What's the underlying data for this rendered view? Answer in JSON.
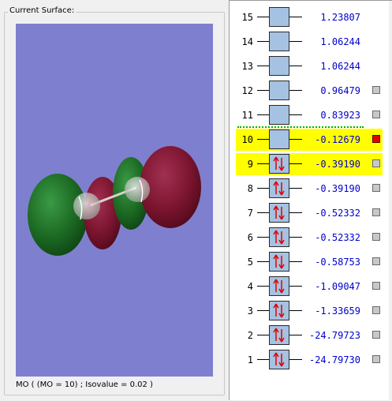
{
  "panel": {
    "group_title": "Current Surface:",
    "status": "MO ( (MO = 10) ; Isovalue = 0.02 )"
  },
  "colors": {
    "viewport_bg": "#7f7fcf",
    "positive_lobe": "#1d6b24",
    "negative_lobe": "#7c1530",
    "highlight": "#ffff00",
    "energy_text": "#0000cc",
    "selected_marker": "#e00000"
  },
  "orbitals": [
    {
      "num": "15",
      "energy": "1.23807",
      "occupied": false,
      "highlight": false,
      "checkbox": false,
      "selected": false
    },
    {
      "num": "14",
      "energy": "1.06244",
      "occupied": false,
      "highlight": false,
      "checkbox": false,
      "selected": false
    },
    {
      "num": "13",
      "energy": "1.06244",
      "occupied": false,
      "highlight": false,
      "checkbox": false,
      "selected": false
    },
    {
      "num": "12",
      "energy": "0.96479",
      "occupied": false,
      "highlight": false,
      "checkbox": true,
      "selected": false
    },
    {
      "num": "11",
      "energy": "0.83923",
      "occupied": false,
      "highlight": false,
      "checkbox": true,
      "selected": false
    },
    {
      "num": "10",
      "energy": "-0.12679",
      "occupied": false,
      "highlight": true,
      "checkbox": true,
      "selected": true
    },
    {
      "num": "9",
      "energy": "-0.39190",
      "occupied": true,
      "highlight": true,
      "checkbox": true,
      "selected": false
    },
    {
      "num": "8",
      "energy": "-0.39190",
      "occupied": true,
      "highlight": false,
      "checkbox": true,
      "selected": false
    },
    {
      "num": "7",
      "energy": "-0.52332",
      "occupied": true,
      "highlight": false,
      "checkbox": true,
      "selected": false
    },
    {
      "num": "6",
      "energy": "-0.52332",
      "occupied": true,
      "highlight": false,
      "checkbox": true,
      "selected": false
    },
    {
      "num": "5",
      "energy": "-0.58753",
      "occupied": true,
      "highlight": false,
      "checkbox": true,
      "selected": false
    },
    {
      "num": "4",
      "energy": "-1.09047",
      "occupied": true,
      "highlight": false,
      "checkbox": true,
      "selected": false
    },
    {
      "num": "3",
      "energy": "-1.33659",
      "occupied": true,
      "highlight": false,
      "checkbox": true,
      "selected": false
    },
    {
      "num": "2",
      "energy": "-24.79723",
      "occupied": true,
      "highlight": false,
      "checkbox": true,
      "selected": false
    },
    {
      "num": "1",
      "energy": "-24.79730",
      "occupied": true,
      "highlight": false,
      "checkbox": true,
      "selected": false
    }
  ]
}
